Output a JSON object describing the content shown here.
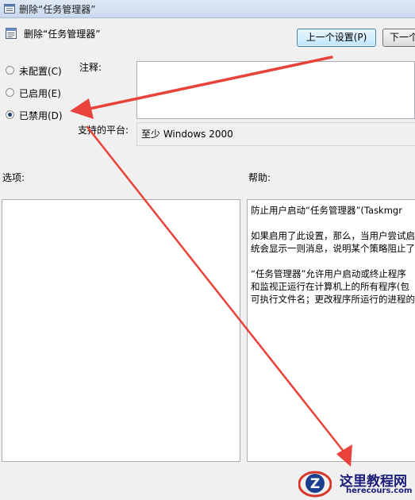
{
  "window": {
    "title": "删除“任务管理器”"
  },
  "header": {
    "title": "删除“任务管理器”",
    "prev_button": "上一个设置(P)",
    "next_button": "下一个"
  },
  "state_options": [
    {
      "label": "未配置(C)",
      "checked": false
    },
    {
      "label": "已启用(E)",
      "checked": false
    },
    {
      "label": "已禁用(D)",
      "checked": true
    }
  ],
  "comment": {
    "label": "注释:",
    "value": ""
  },
  "platform": {
    "label": "支持的平台:",
    "value": "至少 Windows 2000"
  },
  "options": {
    "label": "选项:"
  },
  "help": {
    "label": "帮助:",
    "paragraphs": [
      "防止用户启动“任务管理器”(Taskmgr",
      "如果启用了此设置，那么，当用户尝试启\n统会显示一则消息，说明某个策略阻止了",
      "“任务管理器”允许用户启动或终止程序\n和监视正运行在计算机上的所有程序(包\n可执行文件名；更改程序所运行的进程的"
    ]
  },
  "annotation": {
    "arrow_color": "#e8423a"
  },
  "watermark": {
    "site_name": "这里教程网",
    "url": "herecours.com",
    "badge_letter": "Z"
  },
  "colors": {
    "window_bg": "#f0f0f0",
    "title_text": "#1e1e1e",
    "accent": "#3c7fb1"
  }
}
